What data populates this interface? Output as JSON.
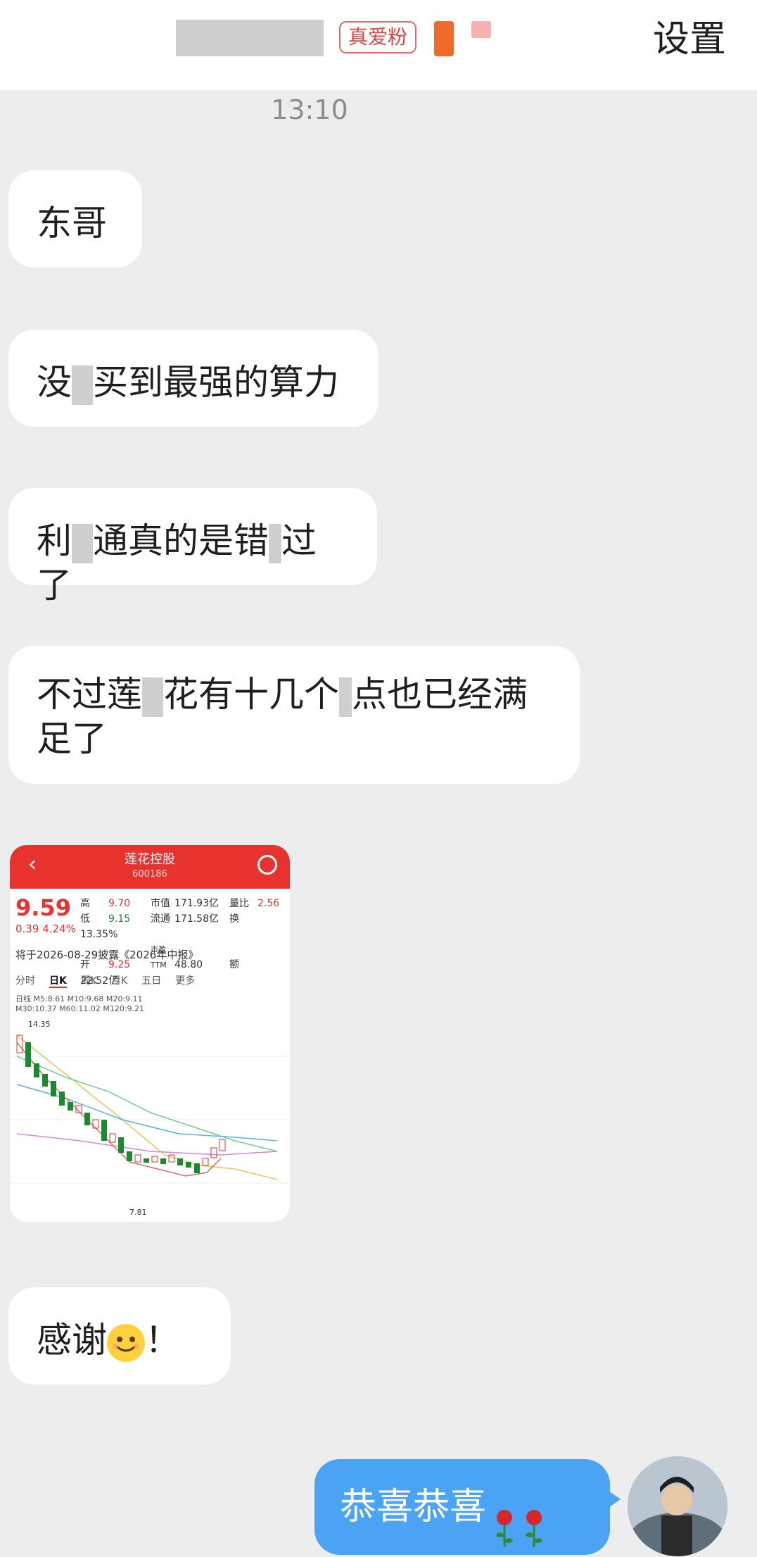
{
  "header": {
    "badge": "真爱粉",
    "settings_label": "设置"
  },
  "timestamp": "13:10",
  "messages": [
    {
      "from": "other",
      "text_parts": [
        "东哥"
      ]
    },
    {
      "from": "other",
      "text_parts": [
        "没",
        "买到最强的算力"
      ]
    },
    {
      "from": "other",
      "text_parts": [
        "利",
        "通真的是错",
        "过了"
      ]
    },
    {
      "from": "other",
      "text_parts": [
        "不过莲",
        "花有十几个",
        "点也已经满足了"
      ]
    },
    {
      "from": "other",
      "text_parts": [
        "感谢",
        "！"
      ]
    },
    {
      "from": "me",
      "text": "恭喜恭喜"
    }
  ],
  "stock_card": {
    "name": "莲花控股",
    "code": "600186",
    "price": "9.59",
    "change": "0.39",
    "change_pct": "4.24%",
    "high_label": "高",
    "high": "9.70",
    "low_label": "低",
    "low": "9.15",
    "open_label": "开",
    "open": "9.25",
    "mktcap_label": "市值",
    "mktcap": "171.93亿",
    "float_label": "流通",
    "float_cap": "171.58亿",
    "pe_label": "市盈TTM",
    "pe": "48.80",
    "volratio_label": "量比",
    "volratio": "2.56",
    "turnover_label": "换",
    "turnover": "13.35%",
    "amount_label": "额",
    "amount": "22.52亿",
    "notice": "将于2026-08-29披露《2026年中报》",
    "tabs": [
      "分时",
      "日K",
      "周K",
      "月K",
      "五日",
      "更多"
    ],
    "active_tab": "日K",
    "ma_line1": "日线 M5:8.61 M10:9.68 M20:9.11",
    "ma_line2": "M30:10.37 M60:11.02 M120:9.21",
    "label_high": "14.35",
    "label_low": "7.81",
    "colors": {
      "up": "#e8322d",
      "down": "#1a8a2e"
    }
  },
  "colors": {
    "self_bubble": "#4ba3f6",
    "background": "#ededed"
  }
}
